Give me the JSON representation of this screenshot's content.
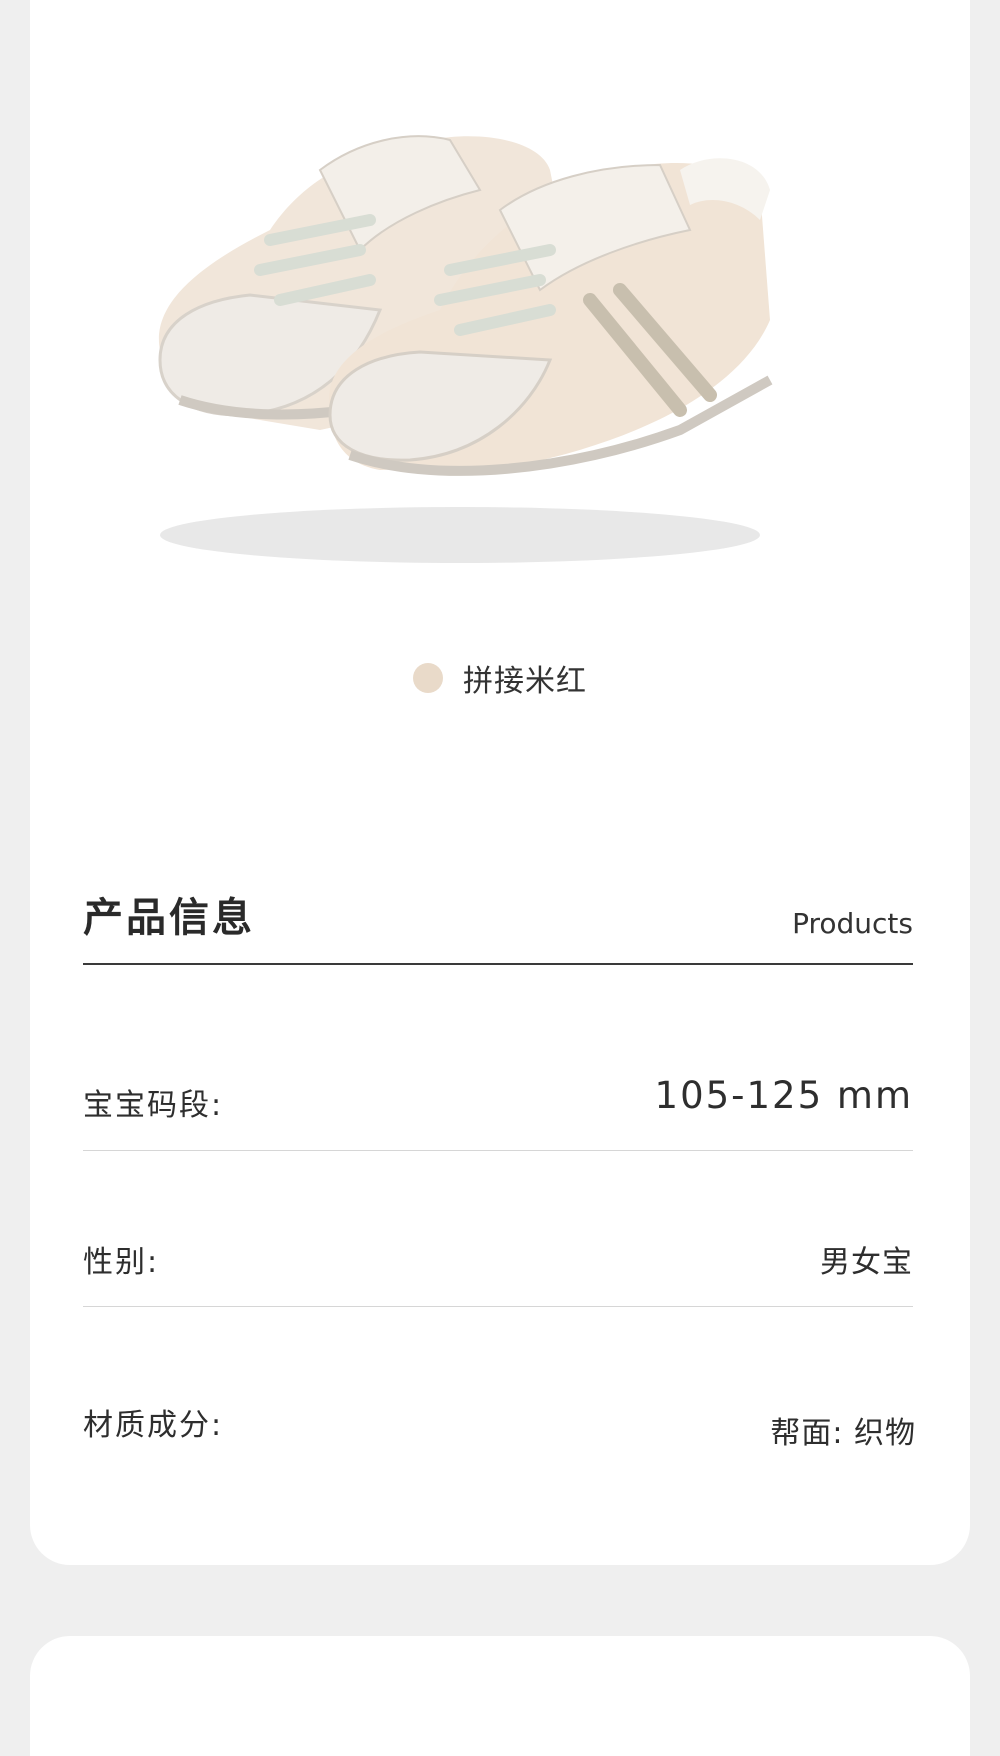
{
  "product": {
    "color_swatch": "#e9dac9",
    "color_name": "拼接米红"
  },
  "section": {
    "title": "产品信息",
    "title_en": "Products"
  },
  "specs": [
    {
      "label": "宝宝码段:",
      "value": "105-125 mm"
    },
    {
      "label": "性别:",
      "value": "男女宝"
    },
    {
      "label": "材质成分:",
      "value": "帮面: 织物"
    }
  ],
  "colors": {
    "background": "#efefef",
    "card": "#ffffff",
    "text": "#2b2b2b",
    "divider": "#d6d6d6"
  }
}
